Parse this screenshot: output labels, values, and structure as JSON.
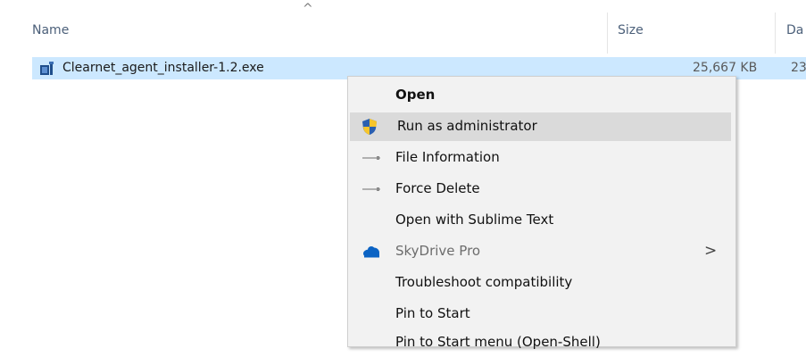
{
  "header": {
    "sort_arrow": "^",
    "col_name": "Name",
    "col_size": "Size",
    "col_date": "Da"
  },
  "file": {
    "name": "Clearnet_agent_installer-1.2.exe",
    "size": "25,667 KB",
    "date": "23"
  },
  "menu": {
    "items": [
      {
        "label": "Open",
        "icon": "",
        "bold": true
      },
      {
        "label": "Run as administrator",
        "icon": "uac-shield-icon"
      },
      {
        "label": "File Information",
        "icon": "line-icon"
      },
      {
        "label": "Force Delete",
        "icon": "line-icon"
      },
      {
        "label": "Open with Sublime Text",
        "icon": ""
      },
      {
        "label": "SkyDrive Pro",
        "icon": "skydrive-cloud-icon",
        "disabled": true,
        "submenu_indicator": ">"
      },
      {
        "label": "Troubleshoot compatibility",
        "icon": ""
      },
      {
        "label": "Pin to Start",
        "icon": ""
      },
      {
        "label": "Pin to Start menu (Open-Shell)",
        "icon": ""
      }
    ]
  },
  "colors": {
    "selection": "#cce8ff",
    "menu_bg": "#f2f2f2",
    "hover": "#dadada",
    "header_text": "#4c607a"
  }
}
